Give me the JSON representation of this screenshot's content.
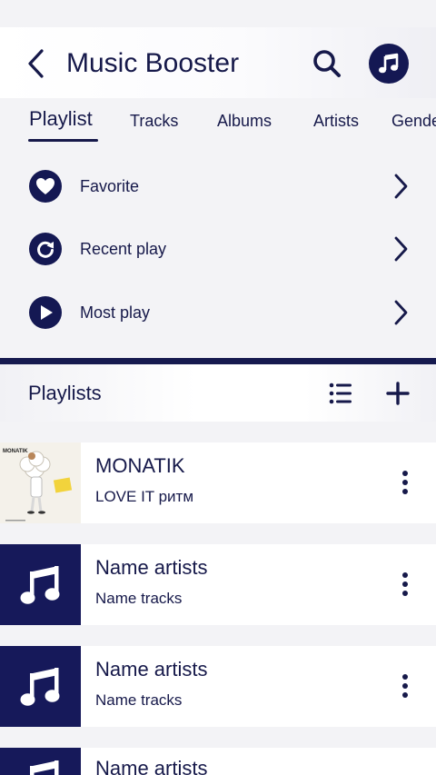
{
  "header": {
    "title": "Music Booster"
  },
  "tabs": [
    {
      "label": "Playlist",
      "active": true
    },
    {
      "label": "Tracks",
      "active": false
    },
    {
      "label": "Albums",
      "active": false
    },
    {
      "label": "Artists",
      "active": false
    },
    {
      "label": "Gende",
      "active": false
    }
  ],
  "quick_access": [
    {
      "label": "Favorite",
      "icon": "heart-icon"
    },
    {
      "label": "Recent play",
      "icon": "refresh-icon"
    },
    {
      "label": "Most play",
      "icon": "play-icon"
    }
  ],
  "playlists": {
    "title": "Playlists",
    "items": [
      {
        "artist": "MONATIK",
        "track": "LOVE IT ритм",
        "cover_text": "MONATIK",
        "thumb": "album-cover"
      },
      {
        "artist": "Name artists",
        "track": "Name tracks",
        "thumb": "music-note-icon"
      },
      {
        "artist": "Name artists",
        "track": "Name tracks",
        "thumb": "music-note-icon"
      },
      {
        "artist": "Name artists",
        "track": "",
        "thumb": "music-note-icon"
      }
    ]
  },
  "colors": {
    "primary": "#141853",
    "background": "#f3f3f6",
    "surface": "#ffffff"
  }
}
